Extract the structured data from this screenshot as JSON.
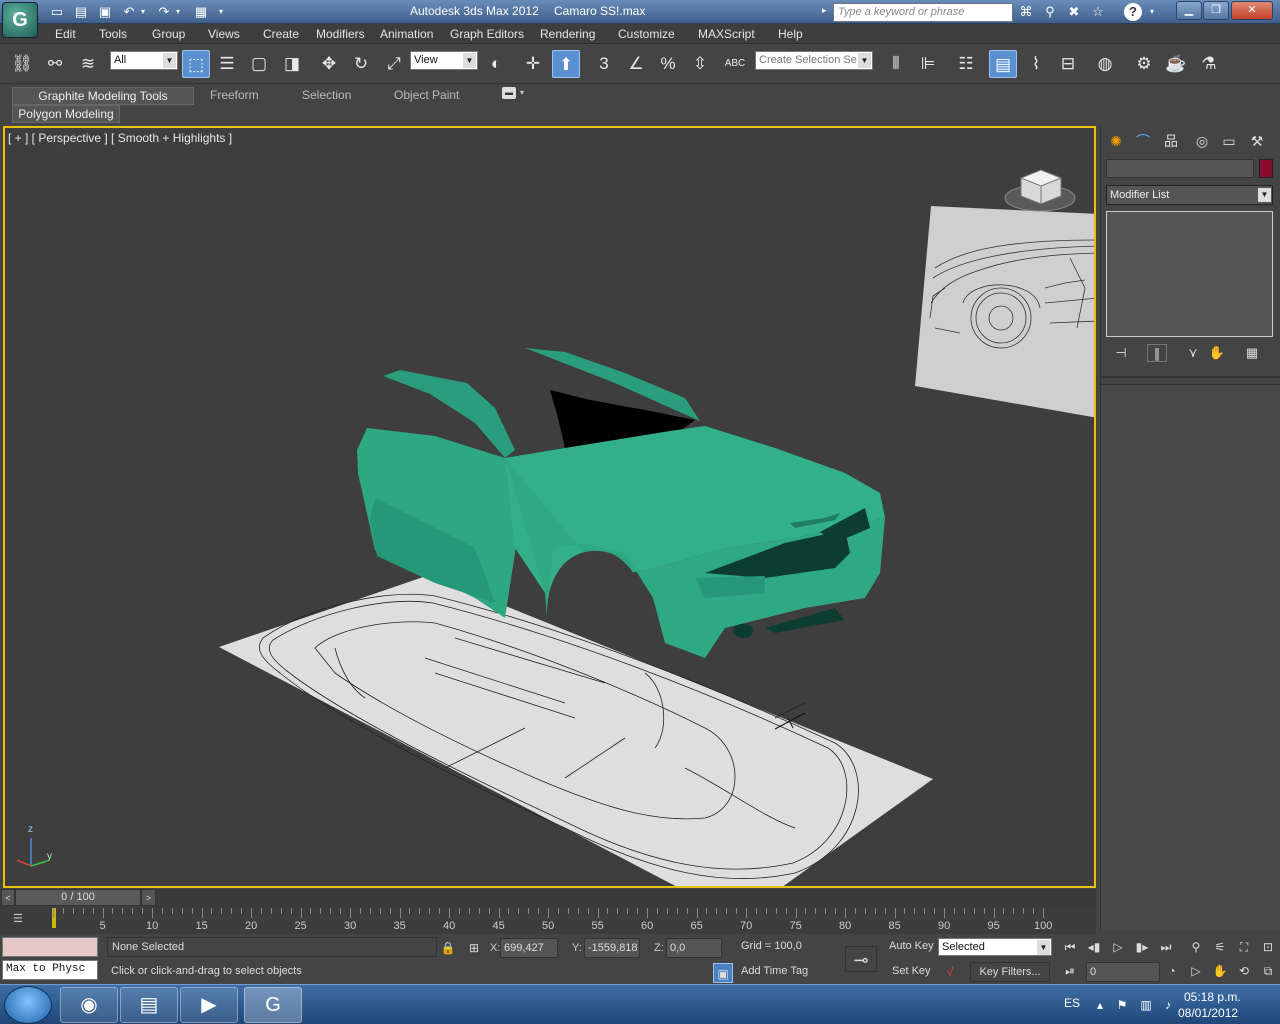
{
  "app": {
    "title": "Autodesk 3ds Max  2012",
    "file": "Camaro SS!.max",
    "search_placeholder": "Type a keyword or phrase"
  },
  "menu": [
    "Edit",
    "Tools",
    "Group",
    "Views",
    "Create",
    "Modifiers",
    "Animation",
    "Graph Editors",
    "Rendering",
    "Customize",
    "MAXScript",
    "Help"
  ],
  "toolbar": {
    "filter_value": "All",
    "ref_coord_value": "View",
    "selection_set_placeholder": "Create Selection Se",
    "snap_label": "3",
    "abc_label": "ABC"
  },
  "ribbon": {
    "tabs": [
      "Graphite Modeling Tools",
      "Freeform",
      "Selection",
      "Object Paint"
    ],
    "active_panel": "Polygon Modeling"
  },
  "viewport": {
    "label": "[ + ] [ Perspective ] [ Smooth + Highlights ]",
    "car_color": "#2ea882",
    "axis": {
      "z": "z",
      "y": "y"
    }
  },
  "command_panel": {
    "modifier_list": "Modifier List",
    "object_color": "#8b0a2f"
  },
  "timeline": {
    "frame_display": "0 / 100",
    "ticks": [
      "5",
      "10",
      "15",
      "20",
      "25",
      "30",
      "35",
      "40",
      "45",
      "50",
      "55",
      "60",
      "65",
      "70",
      "75",
      "80",
      "85",
      "90",
      "95",
      "100"
    ]
  },
  "status": {
    "maxscript": "Max to Physc",
    "selection": "None Selected",
    "prompt": "Click or click-and-drag to select objects",
    "x_label": "X:",
    "x_value": "699,427",
    "y_label": "Y:",
    "y_value": "-1559,818",
    "z_label": "Z:",
    "z_value": "0,0",
    "grid": "Grid = 100,0",
    "add_time_tag": "Add Time Tag",
    "auto_key": "Auto Key",
    "set_key": "Set Key",
    "key_mode": "Selected",
    "key_filters": "Key Filters...",
    "frame": "0"
  },
  "taskbar": {
    "language": "ES",
    "time": "05:18 p.m.",
    "date": "08/01/2012"
  }
}
